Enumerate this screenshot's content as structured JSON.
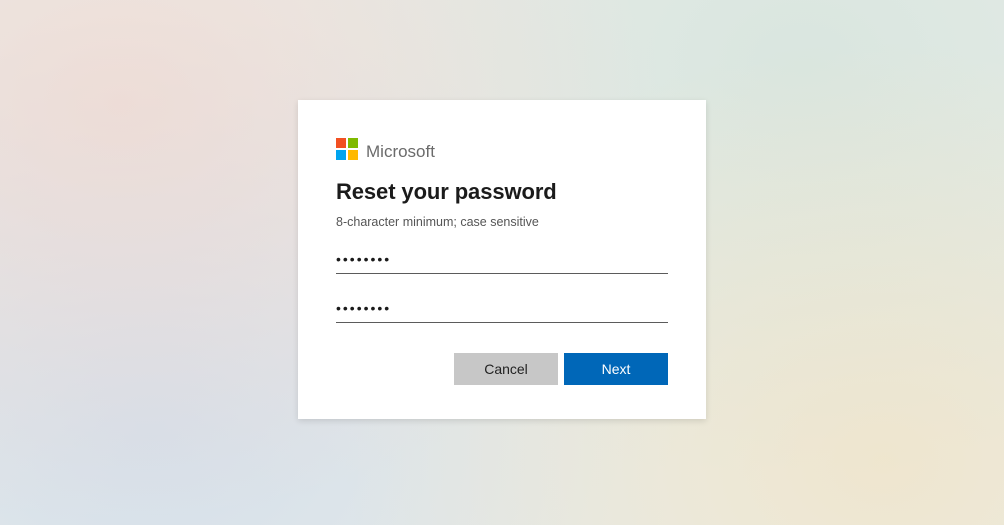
{
  "brand": {
    "name": "Microsoft"
  },
  "dialog": {
    "title": "Reset your password",
    "hint": "8-character minimum; case sensitive",
    "password1_value": "••••••••",
    "password2_value": "••••••••",
    "cancel_label": "Cancel",
    "next_label": "Next"
  }
}
